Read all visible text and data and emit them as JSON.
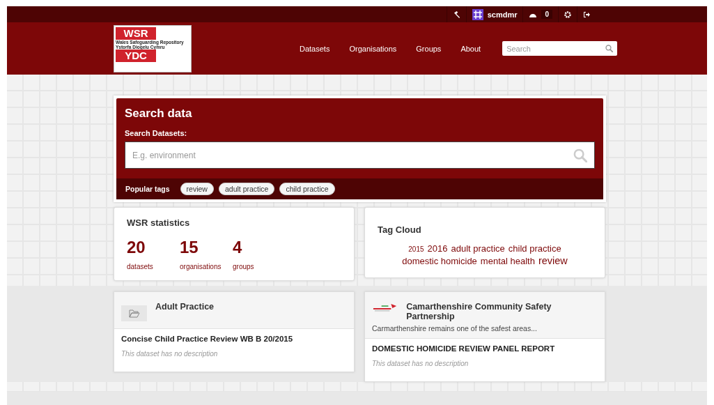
{
  "account_bar": {
    "username": "scmdmr",
    "activity_count": "0"
  },
  "logo": {
    "top": "WSR",
    "line_1": "Wales Safeguarding Repository",
    "line_2": "Ystorfa Diogelu Cymru",
    "bottom": "YDC"
  },
  "nav": [
    "Datasets",
    "Organisations",
    "Groups",
    "About"
  ],
  "header_search": {
    "placeholder": "Search"
  },
  "search_panel": {
    "title": "Search data",
    "label": "Search Datasets:",
    "placeholder": "E.g. environment",
    "popular_label": "Popular tags",
    "tags": [
      "review",
      "adult practice",
      "child practice"
    ]
  },
  "statistics": {
    "title": "WSR statistics",
    "items": [
      {
        "value": "20",
        "label": "datasets"
      },
      {
        "value": "15",
        "label": "organisations"
      },
      {
        "value": "4",
        "label": "groups"
      }
    ]
  },
  "tag_cloud": {
    "title": "Tag Cloud",
    "tags": [
      {
        "label": "2015",
        "kind": "small"
      },
      {
        "label": "2016",
        "kind": "medium"
      },
      {
        "label": "adult practice",
        "kind": "medium"
      },
      {
        "label": "child practice",
        "kind": "medium"
      },
      {
        "label": "domestic homicide",
        "kind": "medium"
      },
      {
        "label": "mental health",
        "kind": "medium"
      },
      {
        "label": "review",
        "kind": "large"
      }
    ]
  },
  "showcase": [
    {
      "kind": "group",
      "title": "Adult Practice",
      "dataset_title": "Concise Child Practice Review WB B 20/2015",
      "dataset_description": "This dataset has no description"
    },
    {
      "kind": "organisation",
      "title": "Camarthenshire Community Safety Partnership",
      "description": "Carmarthenshire remains one of the safest areas...",
      "dataset_title": "DOMESTIC HOMICIDE REVIEW PANEL REPORT",
      "dataset_description": "This dataset has no description"
    }
  ]
}
